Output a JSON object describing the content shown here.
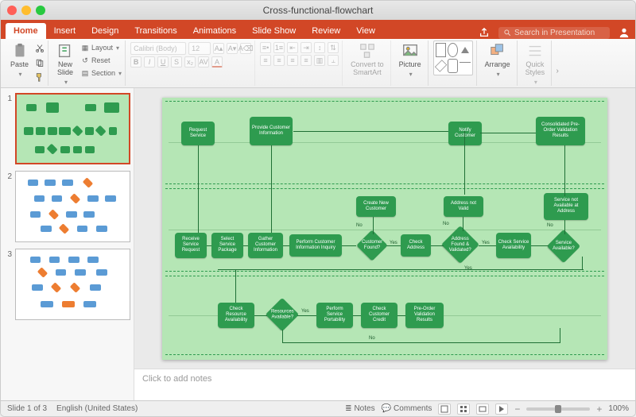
{
  "window": {
    "title": "Cross-functional-flowchart"
  },
  "tabs": [
    "Home",
    "Insert",
    "Design",
    "Transitions",
    "Animations",
    "Slide Show",
    "Review",
    "View"
  ],
  "active_tab": "Home",
  "search": {
    "placeholder": "Search in Presentation"
  },
  "ribbon": {
    "paste": "Paste",
    "new_slide": "New\nSlide",
    "layout": "Layout",
    "reset": "Reset",
    "section": "Section",
    "font_name": "Calibri (Body)",
    "font_size": "12",
    "convert_smartart": "Convert to\nSmartArt",
    "picture": "Picture",
    "arrange": "Arrange",
    "quick_styles": "Quick\nStyles"
  },
  "thumbs": [
    {
      "num": "1",
      "selected": true
    },
    {
      "num": "2",
      "selected": false
    },
    {
      "num": "3",
      "selected": false
    }
  ],
  "flowchart": {
    "lane1": {
      "n1": "Request\nService",
      "n2": "Provide\nCustomer\nInformation",
      "n3": "Notify\nCustomer",
      "n4": "Consolidated\nPre-Order\nValidation Results"
    },
    "lane2": {
      "a1": "Receive\nService\nRequest",
      "a2": "Select\nService\nPackage",
      "a3": "Gather\nCustomer\nInformation",
      "a4": "Perform Customer\nInformation Inquiry",
      "d1": "Customer\nFound?",
      "a5": "Check\nAddress",
      "d2": "Address\nFound &\nValidated?",
      "a6": "Check\nService\nAvailability",
      "d3": "Service\nAvailable?",
      "a7": "Create New\nCustomer",
      "a8": "Address not\nValid",
      "a9": "Service not\nAvailable at\nAddress"
    },
    "lane3": {
      "b1": "Check\nResource\nAvailability",
      "d4": "Resources\nAvailable?",
      "b2": "Perform\nService\nPortability",
      "b3": "Check\nCustomer\nCredit",
      "b4": "Pre-Order\nValidation\nResults"
    },
    "labels": {
      "yes": "Yes",
      "no": "No"
    }
  },
  "notes": {
    "placeholder": "Click to add notes"
  },
  "status": {
    "slide": "Slide 1 of 3",
    "language": "English (United States)",
    "notes_btn": "Notes",
    "comments_btn": "Comments",
    "zoom": "100%"
  }
}
